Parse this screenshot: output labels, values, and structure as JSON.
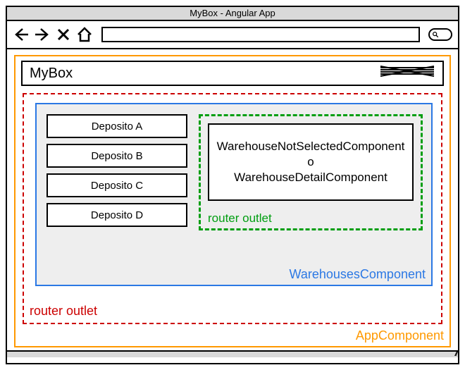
{
  "browser": {
    "title": "MyBox - Angular App"
  },
  "header": {
    "app_name": "MyBox"
  },
  "components": {
    "app_label": "AppComponent",
    "outer_router_label": "router outlet",
    "warehouses_label": "WarehousesComponent",
    "inner_router_label": "router outlet",
    "detail_line1": "WarehouseNotSelectedComponent",
    "detail_or": "o",
    "detail_line2": "WarehouseDetailComponent"
  },
  "deposits": [
    {
      "label": "Deposito A"
    },
    {
      "label": "Deposito B"
    },
    {
      "label": "Deposito C"
    },
    {
      "label": "Deposito D"
    }
  ],
  "colors": {
    "app": "#ff9900",
    "router_outer": "#cc0000",
    "warehouses": "#2b78e4",
    "router_inner": "#009e11"
  }
}
